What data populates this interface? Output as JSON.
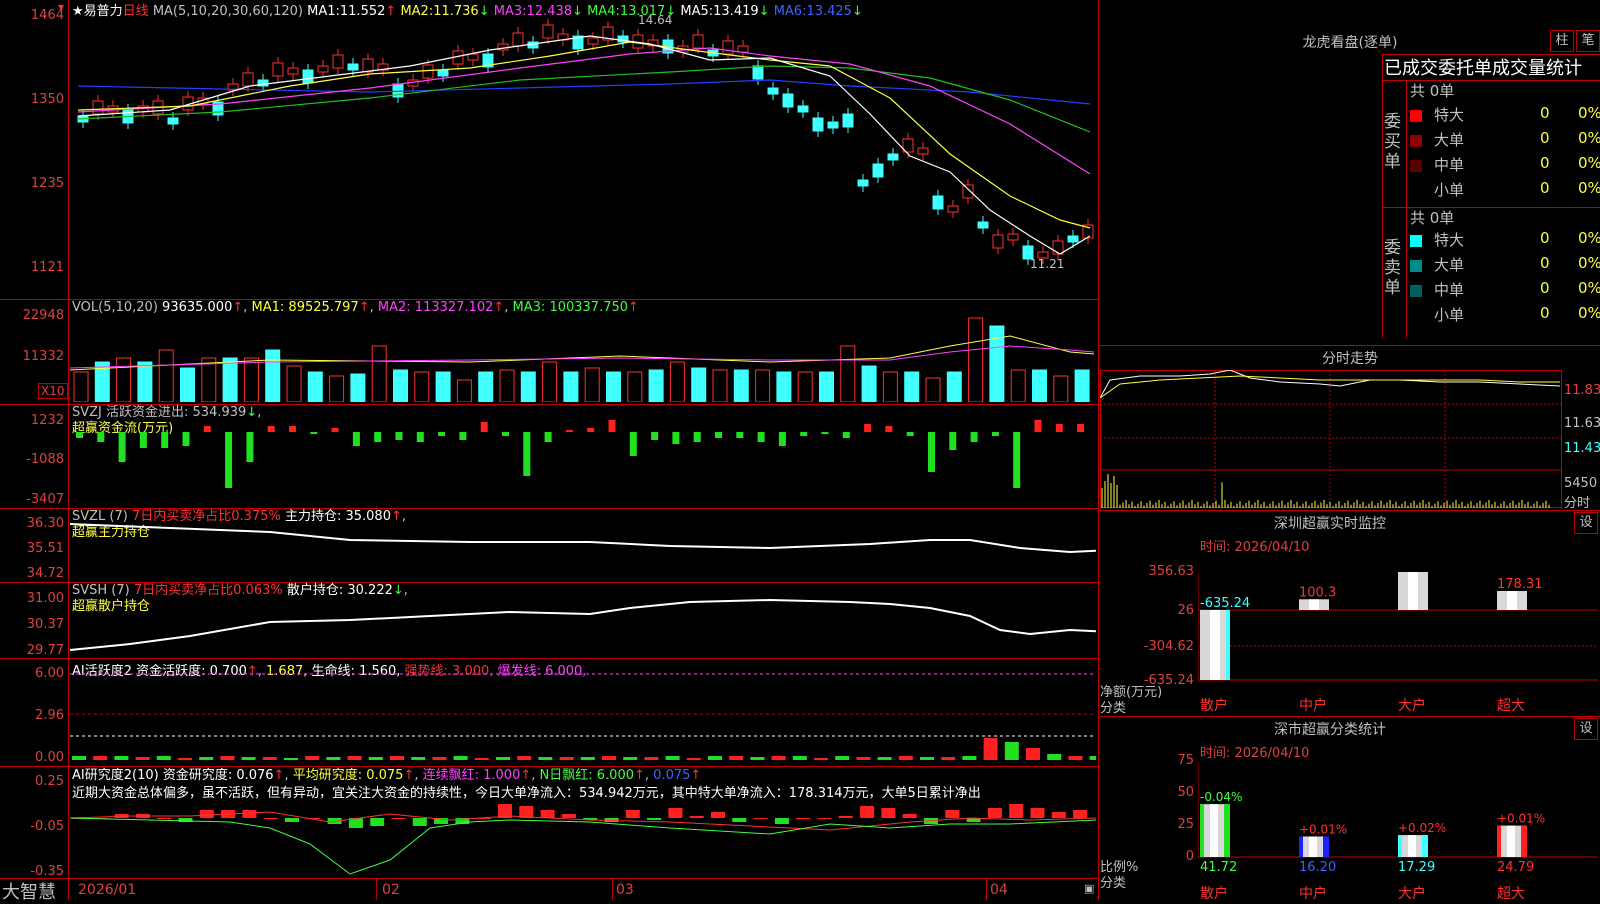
{
  "app_name": "大智慧",
  "header": {
    "stock_name": "★易普力",
    "period": "日线",
    "ma_title": "MA(5,10,20,30,60,120)",
    "ma": [
      {
        "label": "MA1:",
        "value": "11.552",
        "arrow": "↑"
      },
      {
        "label": "MA2:",
        "value": "11.736",
        "arrow": "↓"
      },
      {
        "label": "MA3:",
        "value": "12.438",
        "arrow": "↓"
      },
      {
        "label": "MA4:",
        "value": "13.017",
        "arrow": "↓"
      },
      {
        "label": "MA5:",
        "value": "13.419",
        "arrow": "↓"
      },
      {
        "label": "MA6:",
        "value": "13.425",
        "arrow": "↓"
      }
    ],
    "high_label": "14.64",
    "low_label": "11.21"
  },
  "price_axis": [
    "1464",
    "1350",
    "1235",
    "1121"
  ],
  "vol": {
    "title": "VOL(5,10,20)",
    "value": "93635.000",
    "ma1": "MA1: 89525.797",
    "ma2": "MA2: 113327.102",
    "ma3": "MA3: 100337.750",
    "axis": [
      "22948",
      "11332"
    ],
    "unit": "X10"
  },
  "svzj": {
    "title": "SVZJ  活跃资金进出: 534.939",
    "subtitle": "超赢资金流(万元)",
    "axis": [
      "1232",
      "-1088",
      "-3407"
    ]
  },
  "svzl": {
    "title": "SVZL (7)",
    "t2": "7日内买卖净占比0.375%",
    "t3": "主力持仓: 35.080",
    "subtitle": "超赢主力持仓",
    "axis": [
      "36.30",
      "35.51",
      "34.72"
    ]
  },
  "svsh": {
    "title": "SVSH (7)",
    "t2": "7日内买卖净占比0.063%",
    "t3": "散户持仓: 30.222",
    "subtitle": "超赢散户持仓",
    "axis": [
      "31.00",
      "30.37",
      "29.77"
    ]
  },
  "ai1": {
    "title": "AI活跃度2 资金活跃度: 0.700",
    "v2": "1.687,",
    "v3": "生命线: 1.560,",
    "v4": "强势线: 3.000,",
    "v5": "爆发线: 6.000,",
    "axis": [
      "6.00",
      "2.96",
      "0.00"
    ]
  },
  "ai2": {
    "title": "AI研究度2(10) 资金研究度: 0.076",
    "v2": "平均研究度: 0.075",
    "v3": "连续飘红: 1.000",
    "v4": "N日飘红: 6.000",
    "v5": "0.075",
    "comment": "近期大资金总体偏多，虽不活跃，但有异动，宜关注大资金的持续性，今日大单净流入：534.942万元，其中特大单净流入：178.314万元，大单5日累计净出",
    "axis": [
      "0.25",
      "-0.05",
      "-0.35"
    ]
  },
  "dates": [
    "2026/01",
    "02",
    "03",
    "04"
  ],
  "right": {
    "lhb_title": "龙虎看盘(逐单)",
    "btn_col": "柱",
    "btn_bi": "笔",
    "section": "已成交委托单成交量统计",
    "buy": {
      "label": "委买单",
      "total": "共 0单",
      "rows": [
        {
          "name": "特大",
          "n": "0",
          "p": "0%",
          "color": "#ff0000"
        },
        {
          "name": "大单",
          "n": "0",
          "p": "0%",
          "color": "#8b0000"
        },
        {
          "name": "中单",
          "n": "0",
          "p": "0%",
          "color": "#5a0000"
        },
        {
          "name": "小单",
          "n": "0",
          "p": "0%",
          "color": "#000000"
        }
      ]
    },
    "sell": {
      "label": "委卖单",
      "total": "共 0单",
      "rows": [
        {
          "name": "特大",
          "n": "0",
          "p": "0%",
          "color": "#00ffff"
        },
        {
          "name": "大单",
          "n": "0",
          "p": "0%",
          "color": "#008b8b"
        },
        {
          "name": "中单",
          "n": "0",
          "p": "0%",
          "color": "#006060"
        },
        {
          "name": "小单",
          "n": "0",
          "p": "0%",
          "color": "#000000"
        }
      ]
    },
    "fs_title": "分时走势",
    "fs_axis": [
      "11.83",
      "11.63",
      "11.43",
      "5450",
      "分时"
    ],
    "sz_title": "深圳超赢实时监控",
    "sz_btn": "设",
    "sz_time": "时间: 2026/04/10",
    "sz_axis": [
      "356.63",
      "26",
      "-304.62",
      "-635.24"
    ],
    "sz_ylabel": "净额(万元)",
    "sz_xlabel": "分类",
    "sz_cats": [
      "散户",
      "中户",
      "大户",
      "超大"
    ],
    "sz_values": [
      -635.24,
      100.3,
      356.63,
      178.31
    ],
    "sz_value_labels": [
      "-635.24",
      "100.3",
      "356.63",
      "178.31"
    ],
    "fl_title": "深市超赢分类统计",
    "fl_btn": "设",
    "fl_time": "时间: 2026/04/10",
    "fl_axis": [
      "75",
      "50",
      "25",
      "0"
    ],
    "fl_ylabel": "比例%",
    "fl_xlabel": "分类",
    "fl_cats": [
      "散户",
      "中户",
      "大户",
      "超大"
    ],
    "fl_values": [
      41.72,
      16.2,
      17.29,
      24.79
    ],
    "fl_value_labels": [
      "41.72",
      "16.20",
      "17.29",
      "24.79"
    ],
    "fl_top_labels": [
      "-0.04%",
      "+0.01%",
      "+0.02%",
      "+0.01%"
    ]
  }
}
